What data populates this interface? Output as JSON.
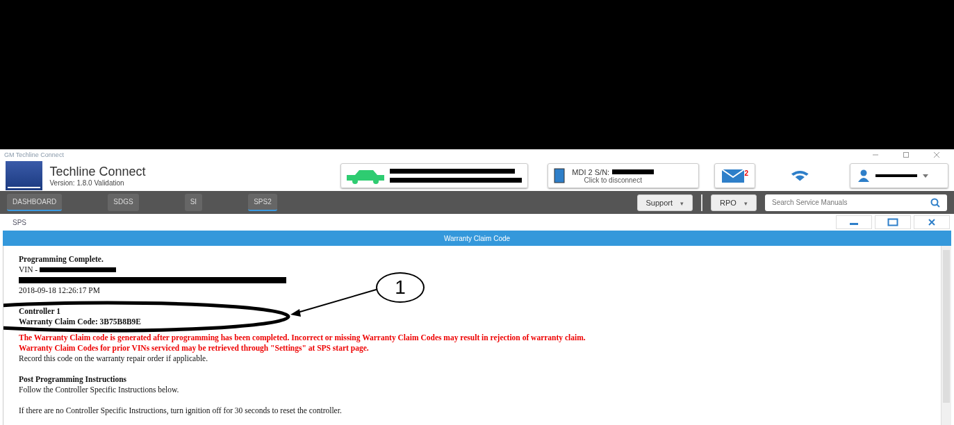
{
  "window": {
    "title": "GM Techline Connect"
  },
  "app": {
    "name": "Techline Connect",
    "version": "Version: 1.8.0 Validation"
  },
  "device": {
    "title": "MDI 2 S/N:",
    "subtitle": "Click to disconnect"
  },
  "messages": {
    "count": "2"
  },
  "nav": {
    "tabs": [
      {
        "label": "DASHBOARD",
        "selected": true
      },
      {
        "label": "SDGS",
        "selected": false
      },
      {
        "label": "SI",
        "selected": false
      },
      {
        "label": "SPS2",
        "selected": true
      }
    ],
    "menus": [
      {
        "label": "Support",
        "caret": "▾"
      },
      {
        "label": "RPO",
        "caret": "▾"
      }
    ],
    "search": {
      "placeholder": "Search Service Manuals"
    }
  },
  "breadcrumb": "SPS",
  "dialog": {
    "title": "Warranty Claim Code",
    "lines": [
      {
        "kind": "bold",
        "text": "Programming Complete."
      },
      {
        "kind": "plain",
        "text": "VIN -"
      },
      {
        "kind": "redacted"
      },
      {
        "kind": "plain",
        "text": "2018-09-18 12:26:17 PM"
      },
      {
        "kind": "gap"
      },
      {
        "kind": "bold",
        "text": "Controller 1"
      },
      {
        "kind": "bold",
        "text": "Warranty Claim Code: 3B75B8B9E"
      },
      {
        "kind": "warning",
        "text": "The Warranty Claim code is generated after programming has been completed. Incorrect or missing Warranty Claim Codes may result in rejection of warranty claim."
      },
      {
        "kind": "warning",
        "text": "Warranty Claim Codes for prior VINs serviced may be retrieved through \"Settings\" at SPS start page."
      },
      {
        "kind": "plain",
        "text": "Record this code on the warranty repair order if applicable."
      },
      {
        "kind": "gap"
      },
      {
        "kind": "bold",
        "text": "Post Programming Instructions"
      },
      {
        "kind": "plain",
        "text": "Follow the Controller Specific Instructions below."
      },
      {
        "kind": "gap"
      },
      {
        "kind": "plain",
        "text": "If there are no Controller Specific Instructions, turn ignition off for 30 seconds to reset the controller."
      }
    ]
  },
  "callout": {
    "label": "1"
  }
}
